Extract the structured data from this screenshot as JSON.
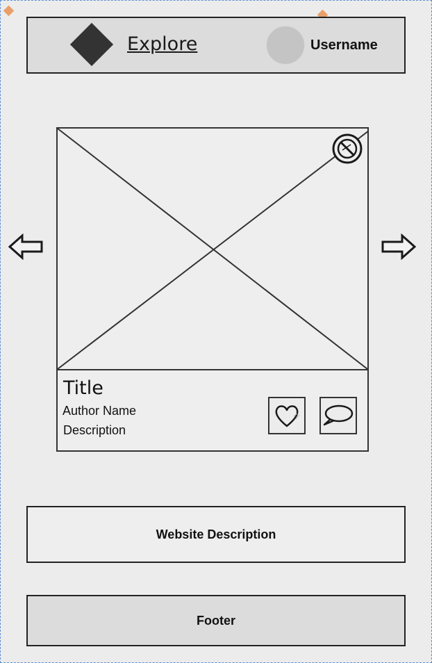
{
  "header": {
    "logo_icon": "diamond-logo-icon",
    "nav_label": "Explore",
    "avatar_icon": "user-avatar-icon",
    "username": "Username"
  },
  "carousel": {
    "prev_icon": "arrow-left-icon",
    "next_icon": "arrow-right-icon",
    "card": {
      "image_icon": "image-placeholder-icon",
      "status_icon": "no-image-icon",
      "title": "Title",
      "author": "Author Name",
      "description": "Description",
      "like_icon": "heart-icon",
      "comment_icon": "comment-icon"
    }
  },
  "website_description": "Website Description",
  "footer": "Footer",
  "colors": {
    "background": "#ececec",
    "header_bg": "#dcdcdc",
    "border": "#222222",
    "selection_handle": "#e8a06a",
    "selection_outline": "#5b8fd6"
  }
}
